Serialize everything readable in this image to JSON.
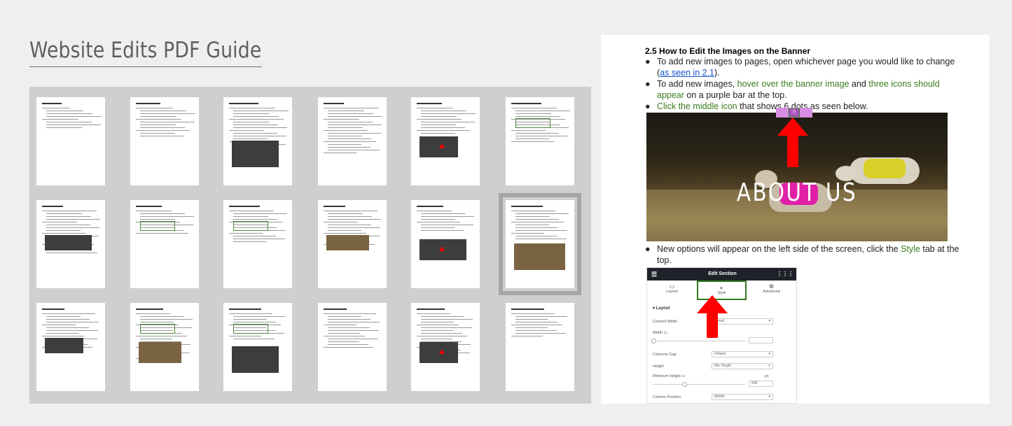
{
  "page": {
    "title": "Website Edits PDF Guide"
  },
  "thumbnails": {
    "count": 18,
    "selected_index": 11
  },
  "preview": {
    "heading": "2.5 How to Edit the Images on the Banner",
    "bullets": [
      {
        "parts": [
          {
            "text": "To add new images to pages, open whichever page you would like to change (",
            "style": "plain"
          },
          {
            "text": "as seen in 2.1",
            "style": "link"
          },
          {
            "text": ").",
            "style": "plain"
          }
        ]
      },
      {
        "parts": [
          {
            "text": "To add new images, ",
            "style": "plain"
          },
          {
            "text": "hover over the banner image",
            "style": "green"
          },
          {
            "text": " and ",
            "style": "plain"
          },
          {
            "text": "three icons should appear",
            "style": "green"
          },
          {
            "text": " on a purple bar at the top.",
            "style": "plain"
          }
        ]
      },
      {
        "parts": [
          {
            "text": "Click the middle icon",
            "style": "green"
          },
          {
            "text": " that shows 6 dots as seen below.",
            "style": "plain"
          }
        ]
      }
    ],
    "banner_text": "ABOUT US",
    "bullet4": {
      "parts": [
        {
          "text": "New options will appear on the left side of the screen, click the ",
          "style": "plain"
        },
        {
          "text": "Style",
          "style": "green"
        },
        {
          "text": " tab at the top.",
          "style": "plain"
        }
      ]
    },
    "panel": {
      "title": "Edit Section",
      "tabs": [
        "Layout",
        "Style",
        "Advanced"
      ],
      "section": "Layout",
      "rows": {
        "content_width": {
          "label": "Content Width",
          "value": "Boxed"
        },
        "width": {
          "label": "Width"
        },
        "columns_gap": {
          "label": "Columns Gap",
          "value": "Default"
        },
        "height": {
          "label": "Height",
          "value": "Min Height"
        },
        "minimum_height": {
          "label": "Minimum Height",
          "value": "500",
          "unit": "px"
        },
        "column_position": {
          "label": "Column Position",
          "value": "Middle"
        }
      }
    }
  },
  "colors": {
    "green": "#3a7d1f",
    "link": "#1155cc",
    "arrow": "#ff0000",
    "purple_bar": "#d58fe0"
  }
}
